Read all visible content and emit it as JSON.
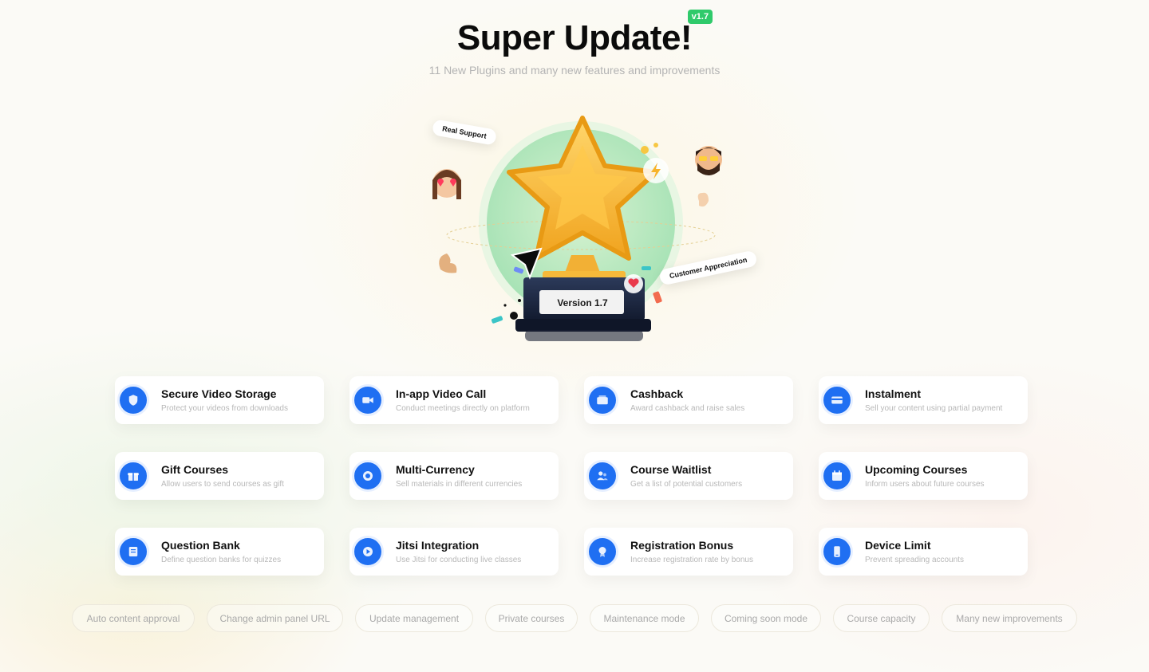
{
  "header": {
    "title": "Super Update!",
    "version_badge": "v1.7",
    "subtitle": "11 New Plugins and many new features and improvements"
  },
  "hero": {
    "label_real_support": "Real Support",
    "label_customer_appreciation": "Customer Appreciation",
    "trophy_plate": "Version 1.7"
  },
  "features": [
    {
      "title": "Secure Video Storage",
      "desc": "Protect your videos from downloads",
      "icon": "shield-icon"
    },
    {
      "title": "In-app Video Call",
      "desc": "Conduct meetings directly on platform",
      "icon": "video-camera-icon"
    },
    {
      "title": "Cashback",
      "desc": "Award cashback and raise sales",
      "icon": "wallet-icon"
    },
    {
      "title": "Instalment",
      "desc": "Sell your content using partial payment",
      "icon": "card-icon"
    },
    {
      "title": "Gift Courses",
      "desc": "Allow users to send courses as gift",
      "icon": "gift-icon"
    },
    {
      "title": "Multi-Currency",
      "desc": "Sell materials in different currencies",
      "icon": "coin-icon"
    },
    {
      "title": "Course Waitlist",
      "desc": "Get a list of potential customers",
      "icon": "users-icon"
    },
    {
      "title": "Upcoming Courses",
      "desc": "Inform users about future courses",
      "icon": "calendar-icon"
    },
    {
      "title": "Question Bank",
      "desc": "Define question banks for quizzes",
      "icon": "document-icon"
    },
    {
      "title": "Jitsi Integration",
      "desc": "Use Jitsi for conducting live classes",
      "icon": "play-icon"
    },
    {
      "title": "Registration Bonus",
      "desc": "Increase registration rate by bonus",
      "icon": "medal-icon"
    },
    {
      "title": "Device Limit",
      "desc": "Prevent spreading accounts",
      "icon": "phone-icon"
    }
  ],
  "chips": [
    "Auto content approval",
    "Change admin panel URL",
    "Update management",
    "Private courses",
    "Maintenance mode",
    "Coming soon mode",
    "Course capacity",
    "Many new improvements"
  ],
  "colors": {
    "accent_blue": "#1f6ff2",
    "badge_green": "#2fca6b",
    "star_gold": "#f7b733"
  }
}
